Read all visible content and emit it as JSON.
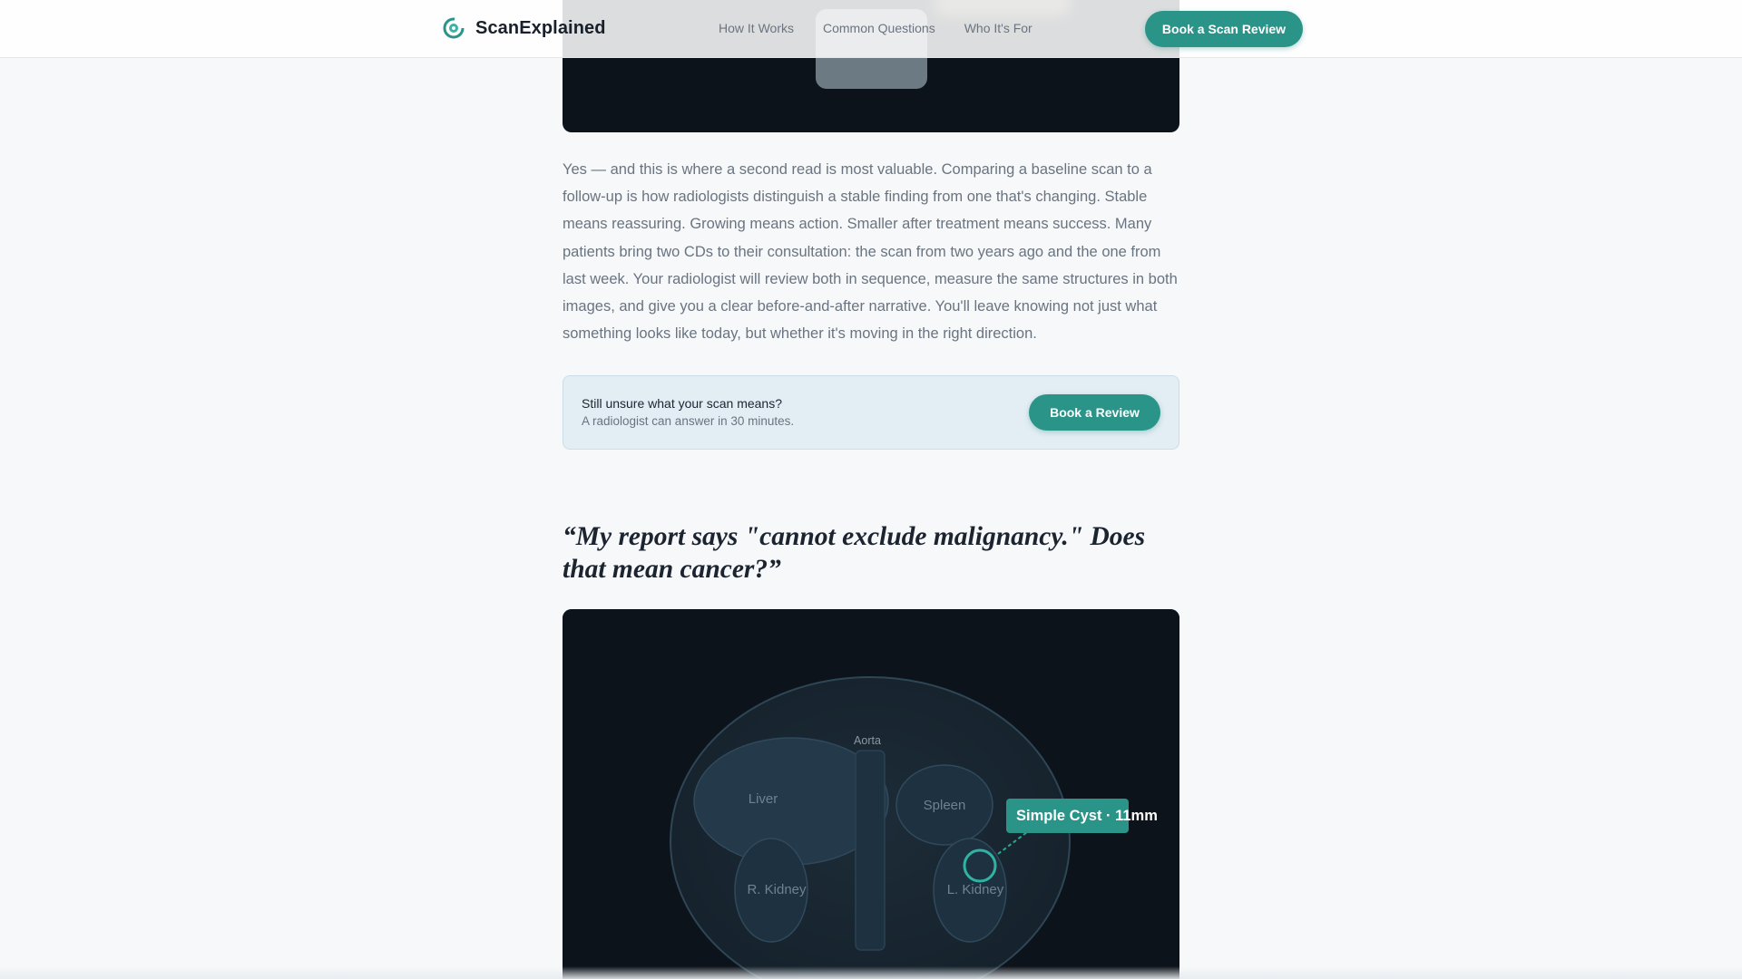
{
  "header": {
    "brand": "ScanExplained",
    "nav": [
      "How It Works",
      "Common Questions",
      "Who It's For"
    ],
    "cta_label": "Book a Scan Review"
  },
  "answer_paragraph": "Yes — and this is where a second read is most valuable. Comparing a baseline scan to a follow-up is how radiologists distinguish a stable finding from one that's changing. Stable means reassuring. Growing means action. Smaller after treatment means success. Many patients bring two CDs to their consultation: the scan from two years ago and the one from last week. Your radiologist will review both in sequence, measure the same structures in both images, and give you a clear before-and-after narrative. You'll leave knowing not just what something looks like today, but whether it's moving in the right direction.",
  "cta_card": {
    "title": "Still unsure what your scan means?",
    "subtitle": "A radiologist can answer in 30 minutes.",
    "button_label": "Book a Review"
  },
  "question_heading": "“My report says \"cannot exclude malignancy.\" Does that mean cancer?”",
  "diagram": {
    "labels": {
      "aorta": "Aorta",
      "liver": "Liver",
      "spleen": "Spleen",
      "r_kidney": "R. Kidney",
      "l_kidney": "L. Kidney"
    },
    "finding_label": "Simple Cyst · 11mm"
  },
  "colors": {
    "accent": "#2a9488",
    "scan_bg": "#0d131a",
    "text_muted": "#6a7480",
    "cta_card_bg": "#e3edf4"
  }
}
